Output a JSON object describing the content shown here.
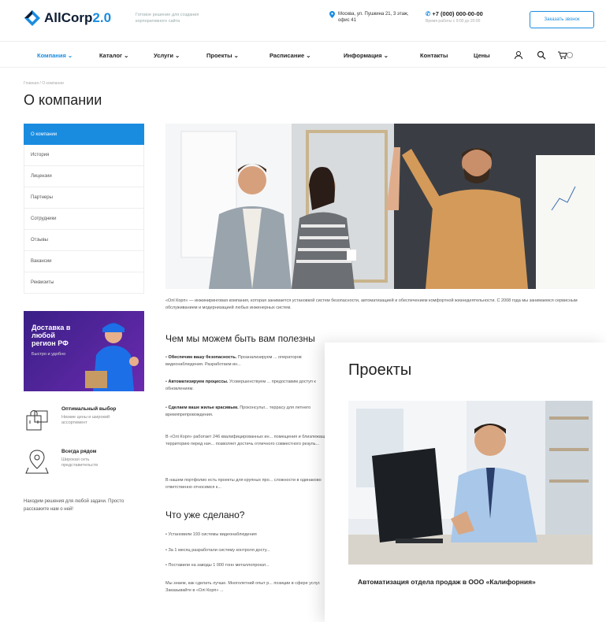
{
  "header": {
    "logo_text": "AllCorp",
    "logo_version": "2.0",
    "tagline": "Готовое решение для создания корпоративного сайта",
    "address": "Москва, ул. Пушкина 21, 3 этаж, офис 41",
    "phone": "+7 (000) 000-00-00",
    "phone_note": "Время работы с 9:00 до 20:00",
    "cta": "Заказать звонок",
    "accent": "#1a8ce0"
  },
  "nav": {
    "items": [
      "Компания",
      "Каталог",
      "Услуги",
      "Проекты",
      "Расписание",
      "Информация",
      "Контакты",
      "Цены"
    ],
    "icons": [
      "user-icon",
      "search-icon",
      "cart-icon"
    ]
  },
  "breadcrumb": "Главная  /  О компании",
  "page_title": "О компании",
  "sidebar": {
    "items": [
      "О компании",
      "История",
      "Лицензии",
      "Партнеры",
      "Сотрудники",
      "Отзывы",
      "Вакансии",
      "Реквизиты"
    ]
  },
  "promo": {
    "title": "Доставка в любой регион РФ",
    "subtitle": "Быстро и удобно"
  },
  "features": [
    {
      "title": "Оптимальный выбор",
      "text": "Низкие цены и широкий ассортимент",
      "icon": "shopping-bags-icon"
    },
    {
      "title": "Всегда рядом",
      "text": "Широкая сеть представительств",
      "icon": "map-pin-icon"
    }
  ],
  "side_note": "Находим решения для любой задачи. Просто расскажите нам о ней!",
  "intro": "«Оnl Корп» — инжиниринговая компания, которая занимается установкой систем безопасности, автоматизацией и обеспечением комфортной жизнедеятельности. С 2008 года мы занимаемся сервисным обслуживанием и модернизацией любых инженерных систем.",
  "section1": {
    "title": "Чем мы можем быть вам полезны",
    "bullets": [
      {
        "b": "Обеспечим вашу безопасность.",
        "t": " Проанализируем ... операторов видеонаблюдения. Разработаем ин..."
      },
      {
        "b": "Автоматизируем процессы.",
        "t": " Усовершенствуем ... предоставим доступ к обновлениям."
      },
      {
        "b": "Сделаем ваше жилье красивым.",
        "t": " Проконсульт... террасу для летнего времяпрепровождения."
      }
    ],
    "p1": "В «Олі Корп» работает 246 квалифицированных ин... помещения и близлежащую территорию перед нач... позволяет достичь отличного совместного резуль...",
    "p2": "В нашем портфолио есть проекты для крупных про... сложности в одинаково ответственно относимся к..."
  },
  "section2": {
    "title": "Что уже сделано?",
    "bullets": [
      "Установили 193 системы видеонаблюдения",
      "За 1 месяц разработали систему контроля досту...",
      "Поставили на заводы 1 000 тонн металлопрокат..."
    ],
    "p": "Мы знаем, как сделать лучше. Многолетний опыт р... позиции в сфере услуг. Заказывайте в «Олі Корп» ..."
  },
  "projects_card": {
    "title": "Проекты",
    "caption": "Автоматизация отдела продаж в ООО «Калифорния»"
  }
}
